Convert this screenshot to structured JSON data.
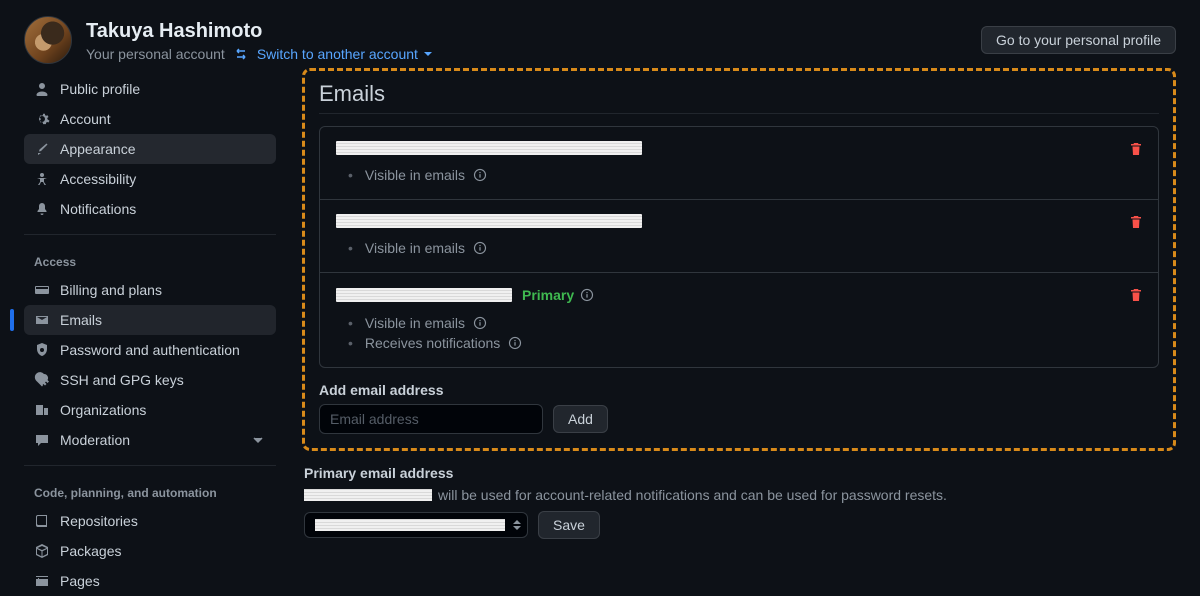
{
  "header": {
    "name": "Takuya Hashimoto",
    "subtitle": "Your personal account",
    "switch_link": "Switch to another account",
    "profile_button": "Go to your personal profile"
  },
  "sidebar": {
    "group1": [
      {
        "label": "Public profile",
        "name": "nav-public-profile"
      },
      {
        "label": "Account",
        "name": "nav-account"
      },
      {
        "label": "Appearance",
        "name": "nav-appearance",
        "selected": true
      },
      {
        "label": "Accessibility",
        "name": "nav-accessibility"
      },
      {
        "label": "Notifications",
        "name": "nav-notifications"
      }
    ],
    "access_title": "Access",
    "group2": [
      {
        "label": "Billing and plans",
        "name": "nav-billing"
      },
      {
        "label": "Emails",
        "name": "nav-emails",
        "active": true
      },
      {
        "label": "Password and authentication",
        "name": "nav-password-auth"
      },
      {
        "label": "SSH and GPG keys",
        "name": "nav-ssh-gpg"
      },
      {
        "label": "Organizations",
        "name": "nav-orgs"
      },
      {
        "label": "Moderation",
        "name": "nav-moderation",
        "chevron": true
      }
    ],
    "code_title": "Code, planning, and automation",
    "group3": [
      {
        "label": "Repositories",
        "name": "nav-repos"
      },
      {
        "label": "Packages",
        "name": "nav-packages"
      },
      {
        "label": "Pages",
        "name": "nav-pages"
      }
    ]
  },
  "main": {
    "title": "Emails",
    "email_items": [
      {
        "redact_w": 306,
        "sublist": [
          "Visible in emails"
        ]
      },
      {
        "redact_w": 306,
        "sublist": [
          "Visible in emails"
        ]
      },
      {
        "redact_w": 176,
        "primary": "Primary",
        "sublist": [
          "Visible in emails",
          "Receives notifications"
        ]
      }
    ],
    "add_label": "Add email address",
    "add_placeholder": "Email address",
    "add_button": "Add",
    "primary_label": "Primary email address",
    "primary_help": "will be used for account-related notifications and can be used for password resets.",
    "save_button": "Save"
  }
}
